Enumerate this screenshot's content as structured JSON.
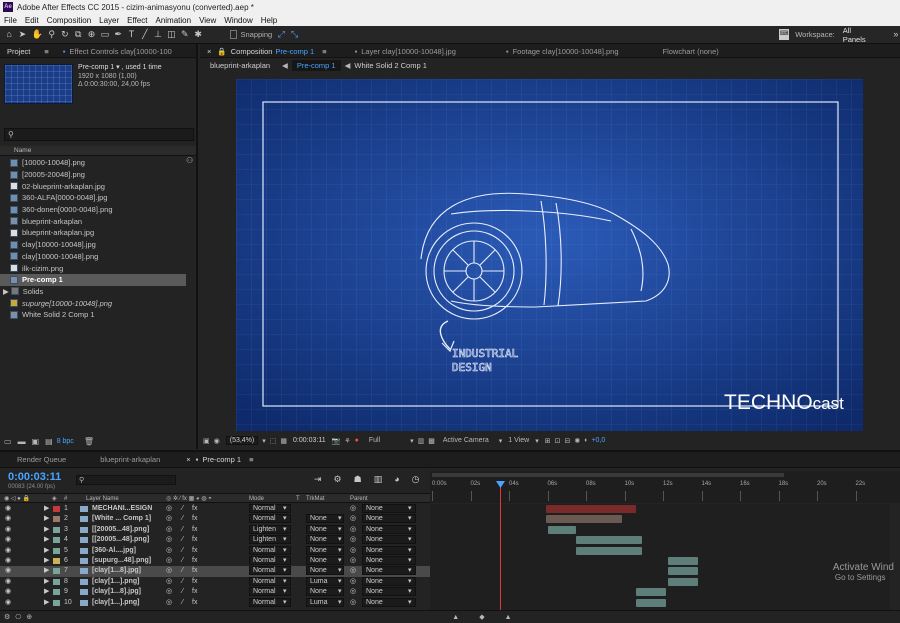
{
  "app_title": "Adobe After Effects CC 2015 - cizim-animasyonu (converted).aep *",
  "menu": [
    "File",
    "Edit",
    "Composition",
    "Layer",
    "Effect",
    "Animation",
    "View",
    "Window",
    "Help"
  ],
  "toolbar": {
    "snapping_label": "Snapping",
    "workspace_label": "Workspace:",
    "workspace_value": "All Panels"
  },
  "left_tabs": [
    "Project",
    "Effect Controls clay[10000-100"
  ],
  "comp_tabs": {
    "composition_prefix": "Composition",
    "composition_name": "Pre-comp 1",
    "layer_tab": "Layer clay[10000-10048].jpg",
    "footage_tab": "Footage clay[10000-10048].png",
    "flowchart_tab": "Flowchart (none)"
  },
  "breadcrumbs": [
    "blueprint-arkaplan",
    "Pre-comp 1",
    "White Solid 2 Comp 1"
  ],
  "project_info": {
    "name": "Pre-comp 1 ▾ , used 1 time",
    "size": "1920 x 1080 (1,00)",
    "duration": "Δ 0:00:30:00, 24,00 fps"
  },
  "project_column_header": "Name",
  "project_items": [
    {
      "label": "[10000-10048].png",
      "selected": false,
      "italic": false
    },
    {
      "label": "[20005-20048].png",
      "selected": false,
      "italic": false
    },
    {
      "label": "02-blueprint-arkaplan.jpg",
      "selected": false,
      "italic": false
    },
    {
      "label": "360-ALFA[0000-0048].jpg",
      "selected": false,
      "italic": false
    },
    {
      "label": "360-donen[0000-0048].png",
      "selected": false,
      "italic": false
    },
    {
      "label": "blueprint-arkaplan",
      "selected": false,
      "italic": false
    },
    {
      "label": "blueprint-arkaplan.jpg",
      "selected": false,
      "italic": false
    },
    {
      "label": "clay[10000-10048].jpg",
      "selected": false,
      "italic": false
    },
    {
      "label": "clay[10000-10048].png",
      "selected": false,
      "italic": false
    },
    {
      "label": "ilk-cizim.png",
      "selected": false,
      "italic": false
    },
    {
      "label": "Pre-comp 1",
      "selected": true,
      "italic": false
    },
    {
      "label": "Solids",
      "selected": false,
      "italic": false
    },
    {
      "label": "supurge[10000-10048].png",
      "selected": false,
      "italic": true
    },
    {
      "label": "White Solid 2 Comp 1",
      "selected": false,
      "italic": false
    }
  ],
  "project_footer": {
    "bpc": "8 bpc"
  },
  "viewer": {
    "caption_line1": "INDUSTRIAL",
    "caption_line2": "DESIGN",
    "brand_big": "TECHNO",
    "brand_small": "cast"
  },
  "viewer_bar": {
    "zoom": "(53,4%)",
    "timecode": "0:00:03:11",
    "resolution": "Full",
    "camera": "Active Camera",
    "views": "1 View",
    "exposure": "+0,0"
  },
  "timeline_tabs": [
    "Render Queue",
    "blueprint-arkaplan",
    "Pre-comp 1"
  ],
  "timeline": {
    "timecode": "0:00:03:11",
    "frames": "00083 (24.00 fps)",
    "headers": {
      "layer_name": "Layer Name",
      "mode": "Mode",
      "t": "T",
      "trkmat": "TrkMat",
      "parent": "Parent"
    },
    "ruler": [
      "0:00s",
      "02s",
      "04s",
      "06s",
      "08s",
      "10s",
      "12s",
      "14s",
      "16s",
      "18s",
      "20s",
      "22s"
    ]
  },
  "layers": [
    {
      "num": "1",
      "name": "MECHANI...ESIGN",
      "mode": "Normal",
      "trkmat": "",
      "parent": "None",
      "color": "#c23b3b",
      "selected": false
    },
    {
      "num": "2",
      "name": "[White ... Comp 1]",
      "mode": "Normal",
      "trkmat": "None",
      "parent": "None",
      "color": "#9a7a6a",
      "selected": false
    },
    {
      "num": "3",
      "name": "[[20005...48].png]",
      "mode": "Lighten",
      "trkmat": "None",
      "parent": "None",
      "color": "#7aa39a",
      "selected": false
    },
    {
      "num": "4",
      "name": "[[20005...48].png]",
      "mode": "Lighten",
      "trkmat": "None",
      "parent": "None",
      "color": "#7aa39a",
      "selected": false
    },
    {
      "num": "5",
      "name": "[360-Al....jpg]",
      "mode": "Normal",
      "trkmat": "None",
      "parent": "None",
      "color": "#7aa39a",
      "selected": false
    },
    {
      "num": "6",
      "name": "[supurg...48].png]",
      "mode": "Normal",
      "trkmat": "None",
      "parent": "None",
      "color": "#c8b25a",
      "selected": false
    },
    {
      "num": "7",
      "name": "[clay[1...8].jpg]",
      "mode": "Normal",
      "trkmat": "None",
      "parent": "None",
      "color": "#7aa39a",
      "selected": true
    },
    {
      "num": "8",
      "name": "[clay[1...].png]",
      "mode": "Normal",
      "trkmat": "Luma",
      "parent": "None",
      "color": "#7aa39a",
      "selected": false
    },
    {
      "num": "9",
      "name": "[clay[1...8].jpg]",
      "mode": "Normal",
      "trkmat": "None",
      "parent": "None",
      "color": "#7aa39a",
      "selected": false
    },
    {
      "num": "10",
      "name": "[clay[1...].png]",
      "mode": "Normal",
      "trkmat": "Luma",
      "parent": "None",
      "color": "#7aa39a",
      "selected": false
    }
  ],
  "watermark": {
    "line1": "Activate Wind",
    "line2": "Go to Settings"
  }
}
